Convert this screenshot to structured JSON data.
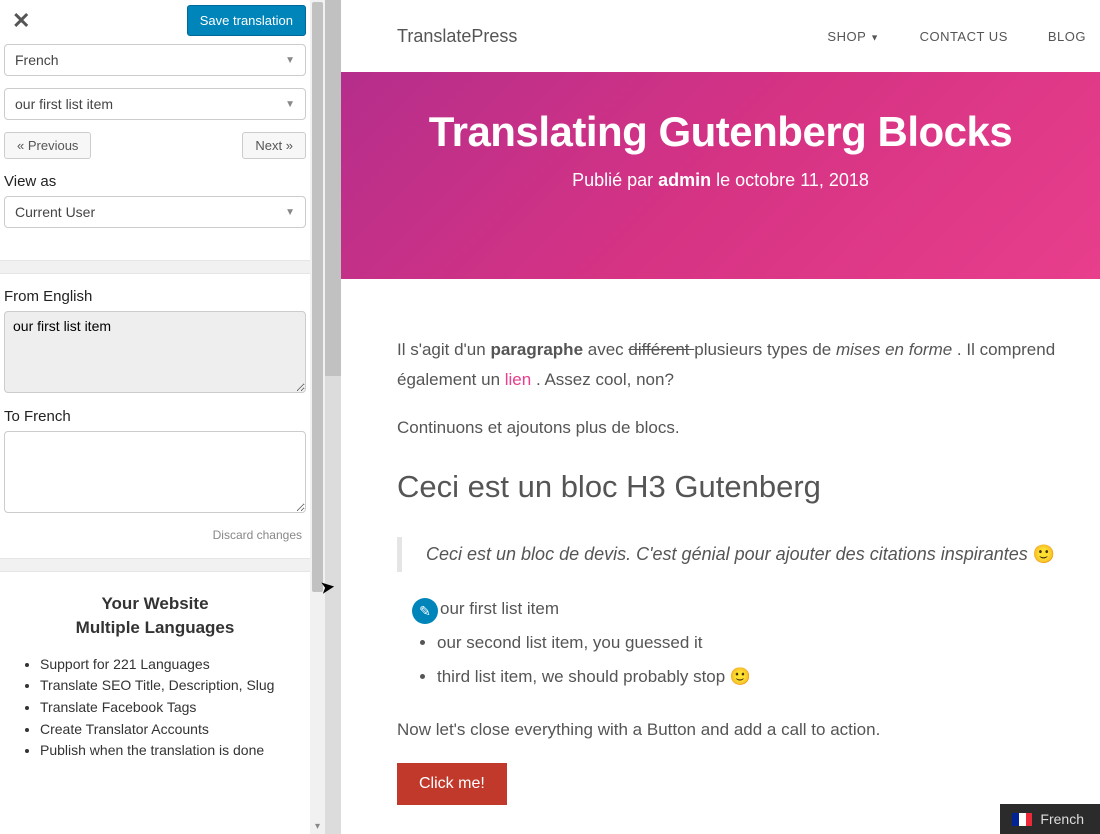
{
  "sidebar": {
    "save_label": "Save translation",
    "language_select": "French",
    "string_select": "our first list item",
    "prev_label": "« Previous",
    "next_label": "Next »",
    "view_as_label": "View as",
    "view_as_value": "Current User",
    "from_label": "From English",
    "from_value": "our first list item",
    "to_label": "To French",
    "to_value": "",
    "discard_label": "Discard changes",
    "promo_title_line1": "Your Website",
    "promo_title_line2": "Multiple Languages",
    "promo_items": [
      "Support for 221 Languages",
      "Translate SEO Title, Description, Slug",
      "Translate Facebook Tags",
      "Create Translator Accounts",
      "Publish when the translation is done"
    ]
  },
  "preview": {
    "brand": "TranslatePress",
    "nav": {
      "shop": "SHOP",
      "contact": "CONTACT US",
      "blog": "BLOG"
    },
    "hero_title": "Translating Gutenberg Blocks",
    "hero_meta_prefix": "Publié par ",
    "hero_meta_author": "admin",
    "hero_meta_suffix": " le octobre 11, 2018",
    "p1_a": "Il s'agit d'un ",
    "p1_bold": "paragraphe",
    "p1_b": " avec ",
    "p1_strike": "différent ",
    "p1_c": "plusieurs types de ",
    "p1_ital": "mises en forme",
    "p1_d": " . Il comprend également un ",
    "p1_link": "lien",
    "p1_e": " . Assez cool, non?",
    "p2": "Continuons et ajoutons plus de blocs.",
    "h3": "Ceci est un bloc H3 Gutenberg",
    "quote": "Ceci est un bloc de devis. C'est génial pour ajouter des citations inspirantes ",
    "list": [
      "our first list item",
      "our second list item, you guessed it",
      "third list item, we should probably stop "
    ],
    "p3": "Now let's close everything with a Button and add a call to action.",
    "cta": "Click me!",
    "lang_switch": "French"
  }
}
